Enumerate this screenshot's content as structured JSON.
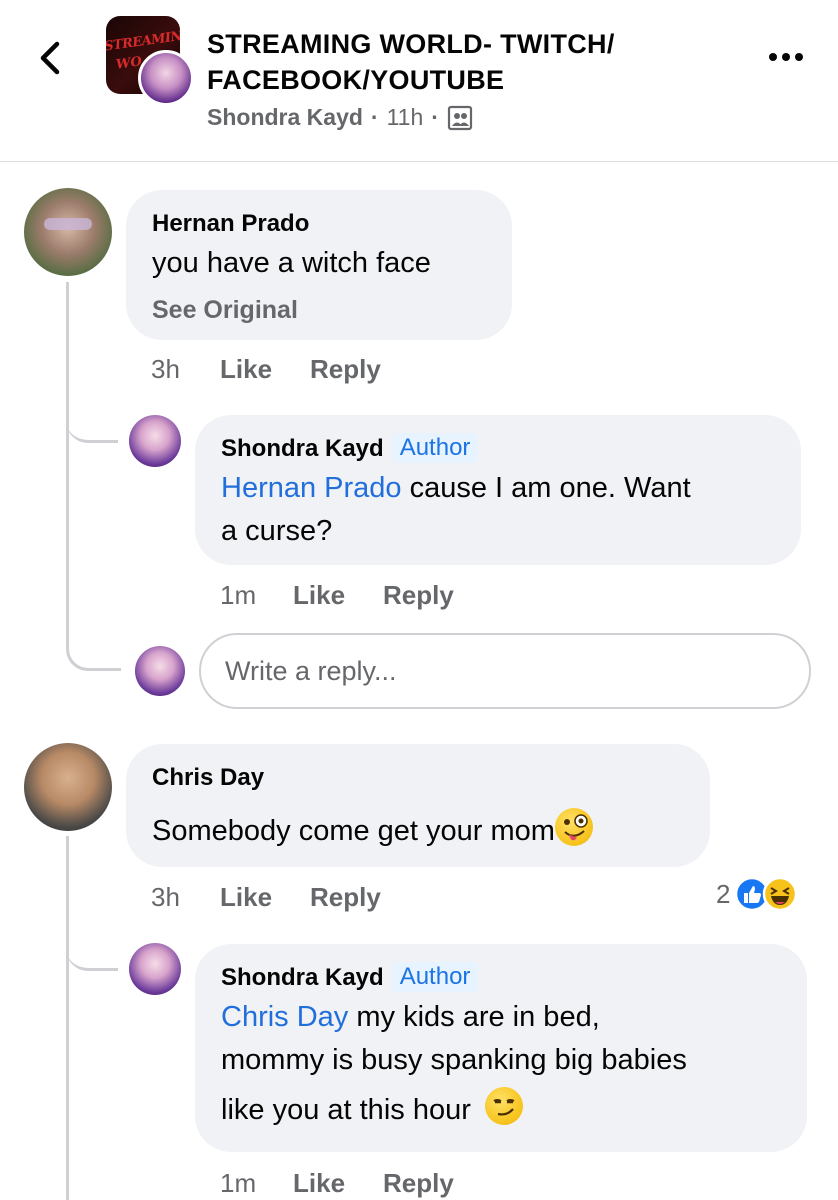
{
  "header": {
    "group_name": "STREAMING WORLD- TWITCH/ FACEBOOK/YOUTUBE",
    "group_logo_text_top": "STREAMING",
    "group_logo_text_bottom": "WO",
    "poster": "Shondra Kayd",
    "time": "11h",
    "separator": "·",
    "privacy_icon": "group-privacy-icon",
    "back_icon": "chevron-left-icon",
    "more_icon": "more-horizontal-icon"
  },
  "comments": [
    {
      "author": "Hernan Prado",
      "text": "you have a witch face",
      "see_original": "See Original",
      "time": "3h",
      "like": "Like",
      "reply": "Reply",
      "replies": [
        {
          "author": "Shondra Kayd",
          "badge": "Author",
          "mention": "Hernan Prado",
          "text_line1": " cause I am one. Want",
          "text_line2": "a curse?",
          "time": "1m",
          "like": "Like",
          "reply": "Reply"
        }
      ],
      "reply_placeholder": "Write a reply..."
    },
    {
      "author": "Chris Day",
      "text": "Somebody come get your mom",
      "emoji": "zany-face-emoji",
      "time": "3h",
      "like": "Like",
      "reply": "Reply",
      "reaction_count": "2",
      "reactions": [
        "like-reaction-icon",
        "haha-reaction-icon"
      ],
      "replies": [
        {
          "author": "Shondra Kayd",
          "badge": "Author",
          "mention": "Chris Day",
          "text_line1": " my kids are in bed,",
          "text_line2": "mommy is busy spanking big babies",
          "text_line3": "like you at this hour",
          "emoji": "smirk-face-emoji",
          "time": "1m",
          "like": "Like",
          "reply": "Reply"
        }
      ]
    }
  ],
  "colors": {
    "link_blue": "#216fdb",
    "bubble_bg": "#f0f2f5",
    "secondary_text": "#65676b",
    "badge_bg": "#e7f3ff"
  }
}
